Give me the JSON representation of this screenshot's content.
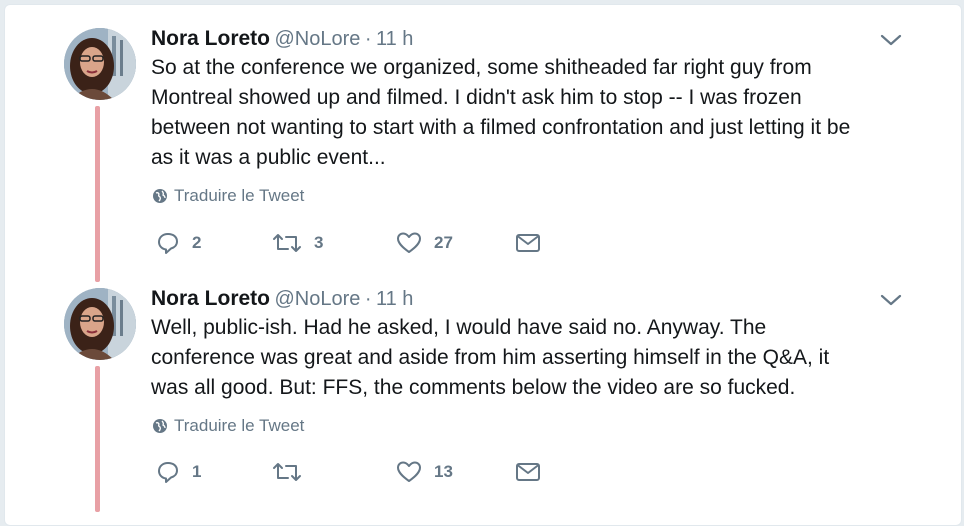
{
  "tweets": [
    {
      "name": "Nora Loreto",
      "handle": "@NoLore",
      "separator": "·",
      "time": "11 h",
      "lines": [
        "So at the conference we organized, some shitheaded far right guy from",
        "Montreal showed up and filmed. I didn't ask him to stop -- I was frozen",
        "between not wanting to start with a filmed confrontation and just letting it be",
        "as it was a public event..."
      ],
      "translate": "Traduire le Tweet",
      "replies": "2",
      "retweets": "3",
      "likes": "27"
    },
    {
      "name": "Nora Loreto",
      "handle": "@NoLore",
      "separator": "·",
      "time": "11 h",
      "lines": [
        "Well, public-ish. Had he asked, I would have said no. Anyway. The",
        "conference was great and aside from him asserting himself in the Q&A, it",
        "was all good.  But: FFS, the comments below the video are so fucked."
      ],
      "translate": "Traduire le Tweet",
      "replies": "1",
      "retweets": "",
      "likes": "13"
    }
  ],
  "icons": {
    "reply": "reply-icon",
    "retweet": "retweet-icon",
    "like": "heart-icon",
    "dm": "envelope-icon",
    "menu": "chevron-down-icon",
    "translate": "globe-icon"
  },
  "colors": {
    "thread_line": "#e8a0a5",
    "text": "#14171a",
    "muted": "#657786",
    "background": "#e6ecf0"
  }
}
